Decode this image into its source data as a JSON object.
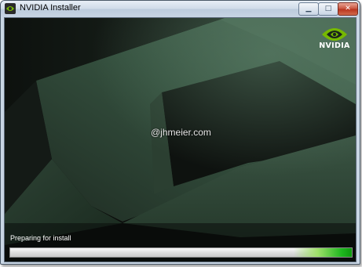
{
  "window": {
    "title": "NVIDIA Installer",
    "controls": {
      "minimize_glyph": "▁",
      "maximize_glyph": "□",
      "close_glyph": "✕"
    }
  },
  "branding": {
    "logo_text": "NVIDIA",
    "logo_icon": "nvidia-eye-icon",
    "accent_color": "#76b900"
  },
  "watermark": "@jhmeier.com",
  "status": {
    "label": "Preparing for install",
    "progress": 1.0
  }
}
